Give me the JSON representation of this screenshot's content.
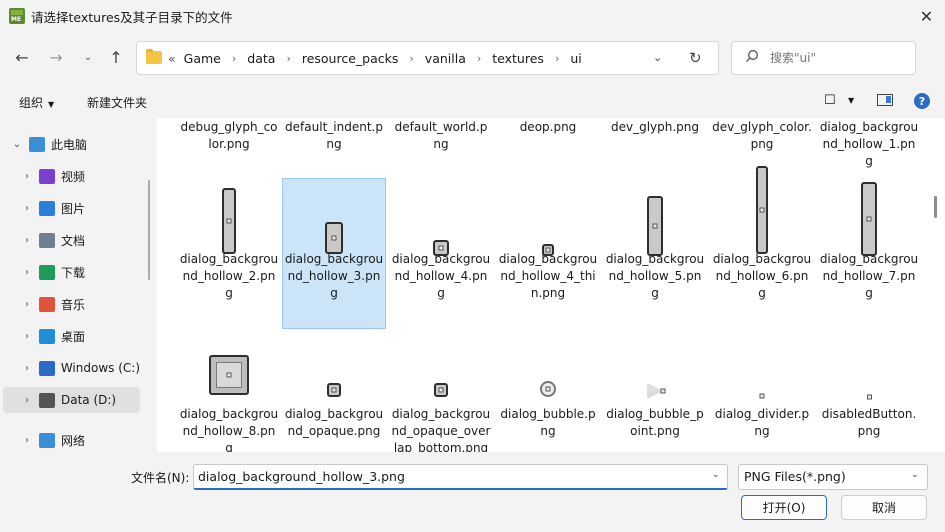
{
  "window": {
    "title": "请选择textures及其子目录下的文件",
    "close_glyph": "✕"
  },
  "nav": {
    "back_glyph": "←",
    "forward_glyph": "→",
    "recent_glyph": "⌄",
    "up_glyph": "↑"
  },
  "address": {
    "lead": "«",
    "crumbs": [
      "Game",
      "data",
      "resource_packs",
      "vanilla",
      "textures",
      "ui"
    ],
    "separator": "›",
    "dropdown_glyph": "⌄",
    "refresh_glyph": "↻"
  },
  "search": {
    "icon": "search-icon",
    "placeholder": "搜索\"ui\""
  },
  "toolbar": {
    "organize_label": "组织",
    "organize_caret": "▼",
    "new_folder_label": "新建文件夹",
    "view_glyph": "☐",
    "view_caret": "▼",
    "help_glyph": "?"
  },
  "sidebar": {
    "items": [
      {
        "label": "此电脑",
        "icon": "computer-icon",
        "color": "#3a8fd6",
        "expanded": true
      },
      {
        "label": "视频",
        "icon": "video-icon",
        "color": "#7a3fd1"
      },
      {
        "label": "图片",
        "icon": "pictures-icon",
        "color": "#2b7fd6"
      },
      {
        "label": "文档",
        "icon": "documents-icon",
        "color": "#6f7f95"
      },
      {
        "label": "下载",
        "icon": "downloads-icon",
        "color": "#1f9c5a"
      },
      {
        "label": "音乐",
        "icon": "music-icon",
        "color": "#e0533d"
      },
      {
        "label": "桌面",
        "icon": "desktop-icon",
        "color": "#1e8fd6"
      },
      {
        "label": "Windows (C:)",
        "icon": "windows-drive-icon",
        "color": "#2b6bc7"
      },
      {
        "label": "Data (D:)",
        "icon": "drive-icon",
        "color": "#555555",
        "selected": true
      },
      {
        "label": "网络",
        "icon": "network-icon",
        "color": "#3a8fd6"
      }
    ]
  },
  "files": [
    {
      "label": "debug_glyph_color.png"
    },
    {
      "label": "default_indent.png"
    },
    {
      "label": "default_world.png"
    },
    {
      "label": "deop.png"
    },
    {
      "label": "dev_glyph.png"
    },
    {
      "label": "dev_glyph_color.png"
    },
    {
      "label": "dialog_background_hollow_1.png"
    },
    {
      "label": "dialog_background_hollow_2.png"
    },
    {
      "label": "dialog_background_hollow_3.png",
      "selected": true
    },
    {
      "label": "dialog_background_hollow_4.png"
    },
    {
      "label": "dialog_background_hollow_4_thin.png"
    },
    {
      "label": "dialog_background_hollow_5.png"
    },
    {
      "label": "dialog_background_hollow_6.png"
    },
    {
      "label": "dialog_background_hollow_7.png"
    },
    {
      "label": "dialog_background_hollow_8.png"
    },
    {
      "label": "dialog_background_opaque.png"
    },
    {
      "label": "dialog_background_opaque_overlap_bottom.png"
    },
    {
      "label": "dialog_bubble.png"
    },
    {
      "label": "dialog_bubble_point.png"
    },
    {
      "label": "dialog_divider.png"
    },
    {
      "label": "disabledButton.png"
    }
  ],
  "bottom": {
    "filename_label": "文件名(N):",
    "filename_value": "dialog_background_hollow_3.png",
    "filetype_value": "PNG Files(*.png)",
    "combo_caret": "⌄",
    "open_label": "打开(O)",
    "cancel_label": "取消"
  }
}
